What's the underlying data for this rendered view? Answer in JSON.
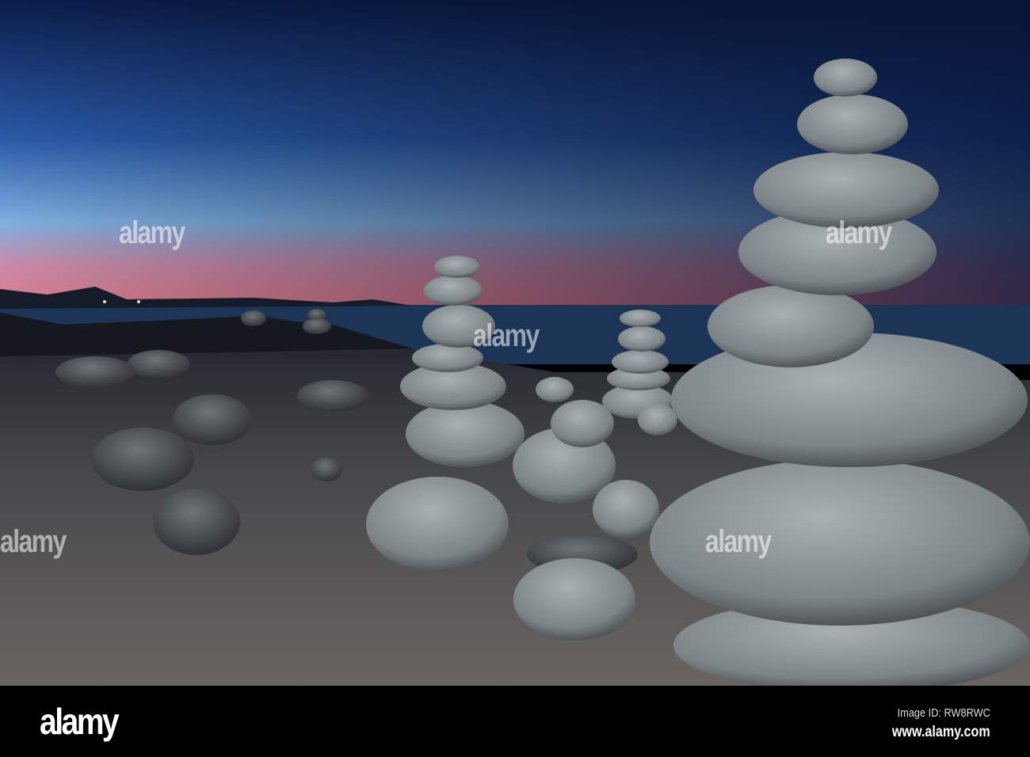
{
  "photo": {
    "subject": "stone-cairns-at-dusk"
  },
  "watermark": {
    "text": "alamy"
  },
  "footer": {
    "logo": "alamy",
    "image_id": "Image ID: RW8RWC",
    "website": "www.alamy.com"
  },
  "colors": {
    "sky_top": "#0d2150",
    "sky_mid": "#3b6bb5",
    "horizon_pink": "#d97a9a",
    "sand": "#5e5c58",
    "stone": "#8e9597"
  }
}
